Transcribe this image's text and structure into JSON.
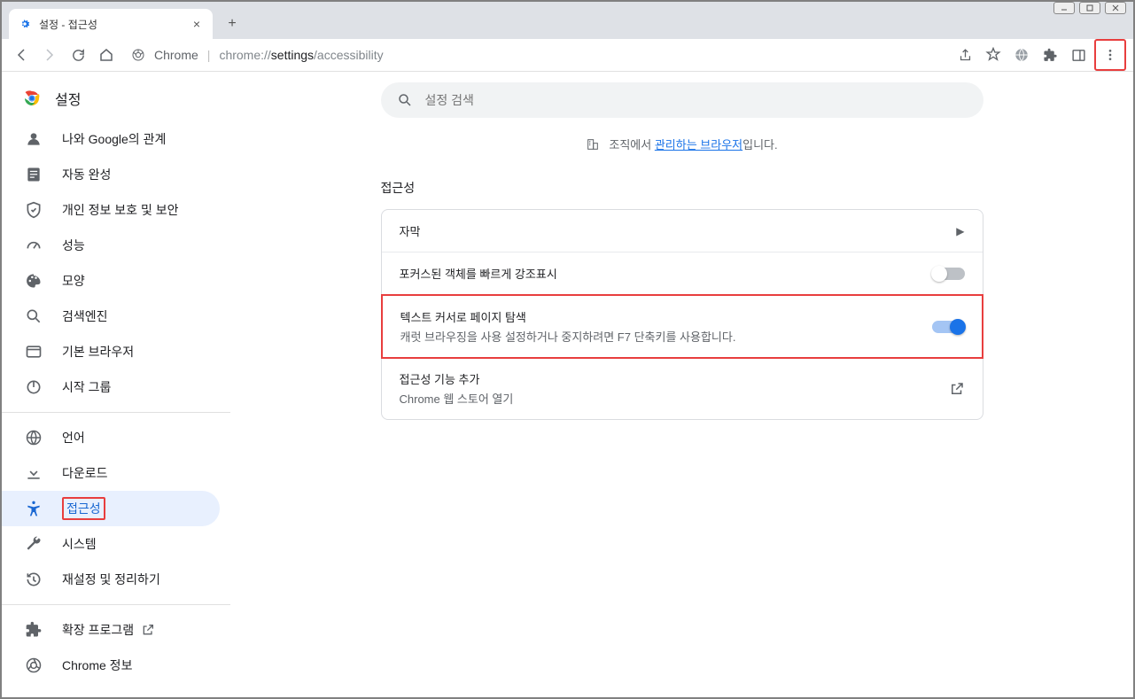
{
  "window": {
    "tab_title": "설정 - 접근성"
  },
  "toolbar": {
    "chrome_label": "Chrome",
    "url_prefix": "chrome://",
    "url_bold": "settings",
    "url_rest": "/accessibility"
  },
  "sidebar": {
    "title": "설정",
    "items": [
      {
        "label": "나와 Google의 관계"
      },
      {
        "label": "자동 완성"
      },
      {
        "label": "개인 정보 보호 및 보안"
      },
      {
        "label": "성능"
      },
      {
        "label": "모양"
      },
      {
        "label": "검색엔진"
      },
      {
        "label": "기본 브라우저"
      },
      {
        "label": "시작 그룹"
      }
    ],
    "items2": [
      {
        "label": "언어"
      },
      {
        "label": "다운로드"
      },
      {
        "label": "접근성"
      },
      {
        "label": "시스템"
      },
      {
        "label": "재설정 및 정리하기"
      }
    ],
    "items3": [
      {
        "label": "확장 프로그램"
      },
      {
        "label": "Chrome 정보"
      }
    ]
  },
  "main": {
    "search_placeholder": "설정 검색",
    "managed_pre": "조직에서 ",
    "managed_link": "관리하는 브라우저",
    "managed_post": "입니다.",
    "section": "접근성",
    "rows": {
      "captions": "자막",
      "focus": "포커스된 객체를 빠르게 강조표시",
      "caret_title": "텍스트 커서로 페이지 탐색",
      "caret_sub": "캐럿 브라우징을 사용 설정하거나 중지하려면 F7 단축키를 사용합니다.",
      "add_title": "접근성 기능 추가",
      "add_sub": "Chrome 웹 스토어 열기"
    }
  }
}
